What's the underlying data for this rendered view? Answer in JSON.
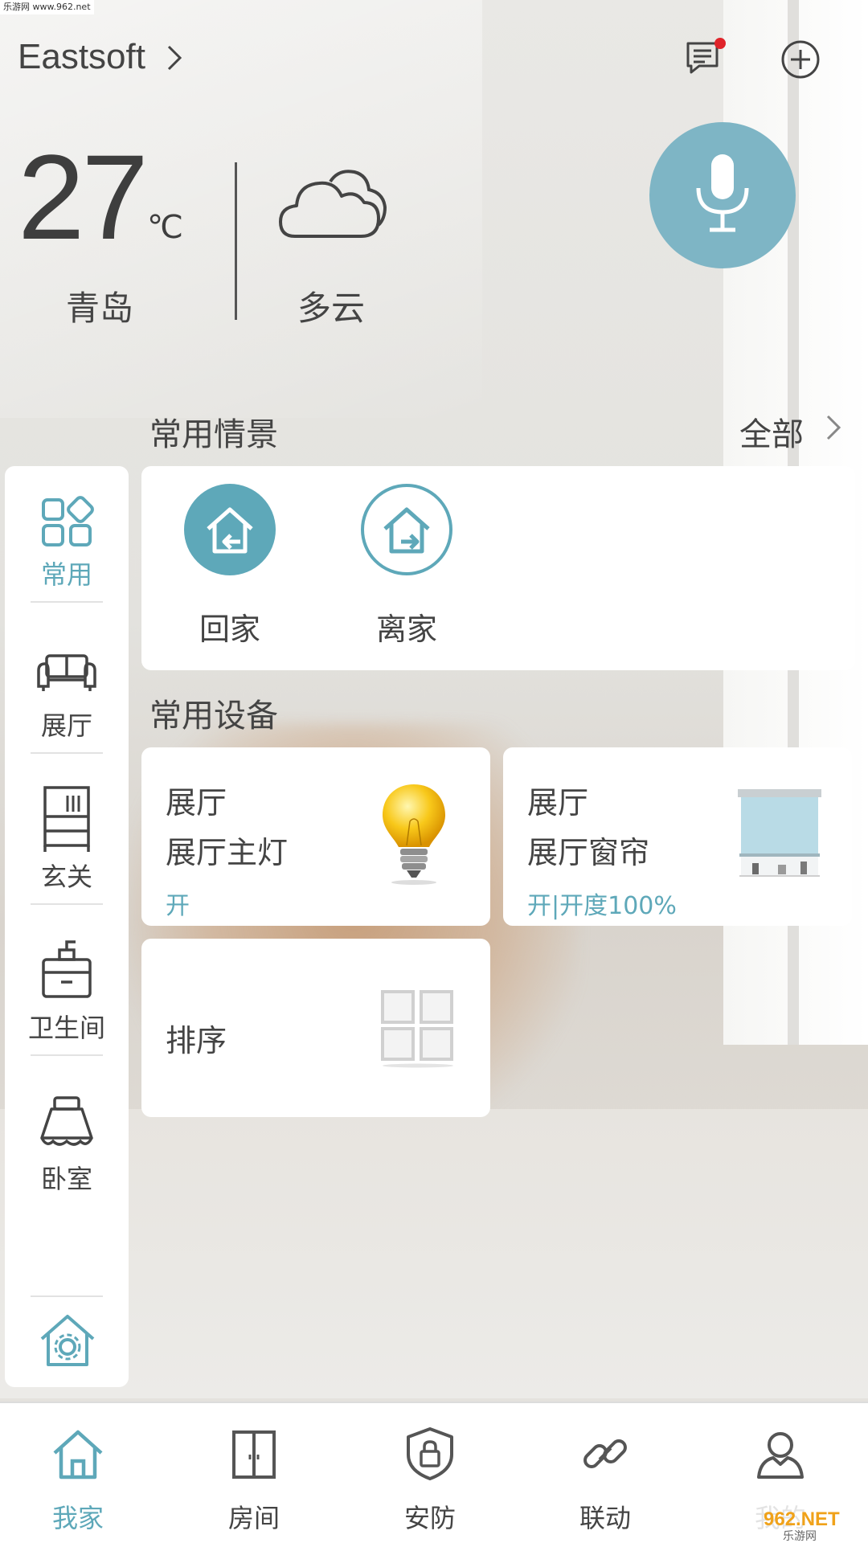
{
  "status_bar": {
    "text": "乐游网 www.962.net"
  },
  "header": {
    "home_name": "Eastsoft"
  },
  "weather": {
    "temperature": "27",
    "unit": "℃",
    "city": "青岛",
    "condition": "多云"
  },
  "scenes": {
    "title": "常用情景",
    "all_label": "全部",
    "items": [
      {
        "label": "回家",
        "style": "filled"
      },
      {
        "label": "离家",
        "style": "outline"
      }
    ]
  },
  "devices": {
    "title": "常用设备",
    "items": [
      {
        "room": "展厅",
        "name": "展厅主灯",
        "status": "开",
        "icon": "light-bulb-icon"
      },
      {
        "room": "展厅",
        "name": "展厅窗帘",
        "status": "开|开度100%",
        "icon": "roller-blind-icon"
      }
    ],
    "sort_label": "排序"
  },
  "sidebar": {
    "items": [
      {
        "label": "常用",
        "icon": "grid-icon",
        "active": true
      },
      {
        "label": "展厅",
        "icon": "sofa-icon",
        "active": false
      },
      {
        "label": "玄关",
        "icon": "shelf-icon",
        "active": false
      },
      {
        "label": "卫生间",
        "icon": "washbasin-icon",
        "active": false
      },
      {
        "label": "卧室",
        "icon": "bed-icon",
        "active": false
      }
    ],
    "settings_icon": "home-settings-icon"
  },
  "tabbar": {
    "items": [
      {
        "label": "我家",
        "icon": "home-icon",
        "active": true
      },
      {
        "label": "房间",
        "icon": "door-icon",
        "active": false
      },
      {
        "label": "安防",
        "icon": "shield-lock-icon",
        "active": false
      },
      {
        "label": "联动",
        "icon": "link-icon",
        "active": false
      },
      {
        "label": "我的",
        "icon": "user-icon",
        "active": false
      }
    ]
  },
  "watermark": {
    "text": "962.NET",
    "subtext": "乐游网"
  },
  "colors": {
    "accent": "#5ea8b9",
    "mic": "#7eb5c5",
    "notification": "#e0242a"
  }
}
